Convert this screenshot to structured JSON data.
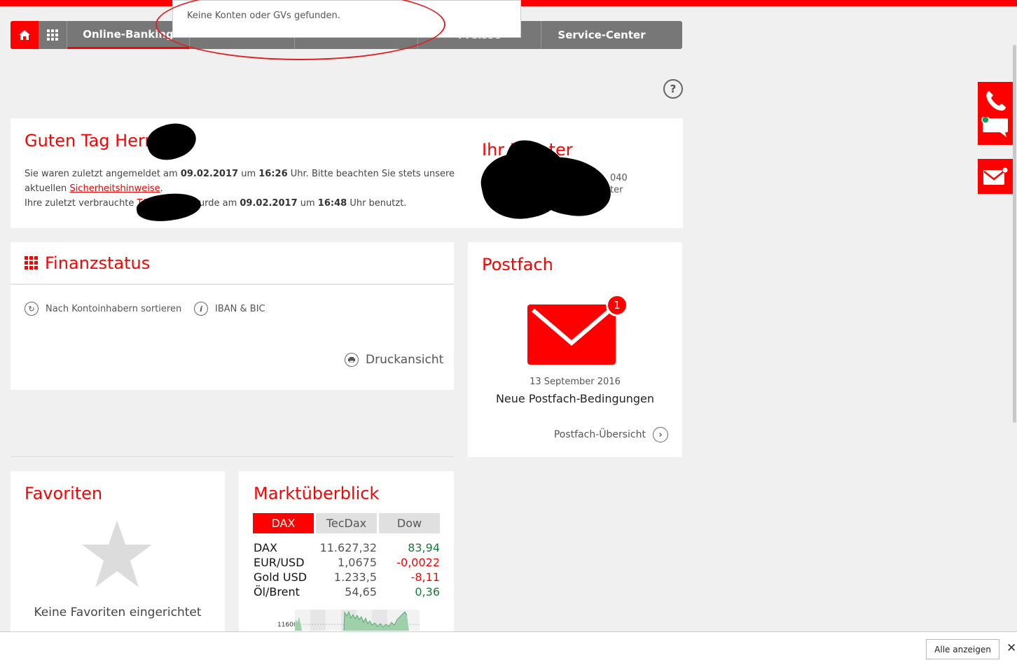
{
  "nav": {
    "items": [
      "Online-Banking",
      "",
      "",
      "Preisse",
      "Service-Center"
    ]
  },
  "toast": {
    "message": "Keine Konten oder GVs gefunden."
  },
  "help": {
    "label": "?"
  },
  "welcome": {
    "greeting": "Guten Tag Herr K",
    "line1_a": "Sie waren zuletzt angemeldet am ",
    "last_login_date": "09.02.2017",
    "line1_b": " um ",
    "last_login_time": "16:26",
    "line1_c": " Uhr. Bitte beachten Sie stets unsere",
    "line2_a": "aktuellen ",
    "security_link": "Sicherheitshinweise",
    "line2_b": ".",
    "line3_a": "Ihre zuletzt verbrauchte ",
    "tan_link": "TAN",
    "line3_b": " wurde am ",
    "tan_date": "09.02.2017",
    "line3_c": " um ",
    "tan_time": "16:48",
    "line3_d": " Uhr benutzt.",
    "advisor_title": "Ihr Berater",
    "advisor_phone_frag": "040",
    "advisor_frag": "ter"
  },
  "finanzstatus": {
    "title": "Finanzstatus",
    "sort_label": "Nach Kontoinhabern sortieren",
    "iban_label": "IBAN & BIC",
    "print_label": "Druckansicht"
  },
  "postfach": {
    "title": "Postfach",
    "badge_count": "1",
    "date": "13 September 2016",
    "subject": "Neue Postfach-Bedingungen",
    "overview_link": "Postfach-Übersicht"
  },
  "favoriten": {
    "title": "Favoriten",
    "empty_text": "Keine Favoriten eingerichtet"
  },
  "markt": {
    "title": "Marktüberblick",
    "tabs": [
      "DAX",
      "TecDax",
      "Dow"
    ],
    "active_tab": "DAX",
    "rows": [
      {
        "name": "DAX",
        "value": "11.627,32",
        "change": "83,94",
        "trend": "pos"
      },
      {
        "name": "EUR/USD",
        "value": "1,0675",
        "change": "-0,0022",
        "trend": "neg"
      },
      {
        "name": "Gold USD",
        "value": "1.233,5",
        "change": "-8,11",
        "trend": "neg"
      },
      {
        "name": "Öl/Brent",
        "value": "54,65",
        "change": "0,36",
        "trend": "pos"
      }
    ],
    "chart_label": "11600"
  },
  "bottom": {
    "show_all": "Alle anzeigen",
    "close": "✕"
  },
  "colors": {
    "brand_red": "#ff0000",
    "nav_gray": "#777777",
    "positive": "#1a7a3a"
  }
}
